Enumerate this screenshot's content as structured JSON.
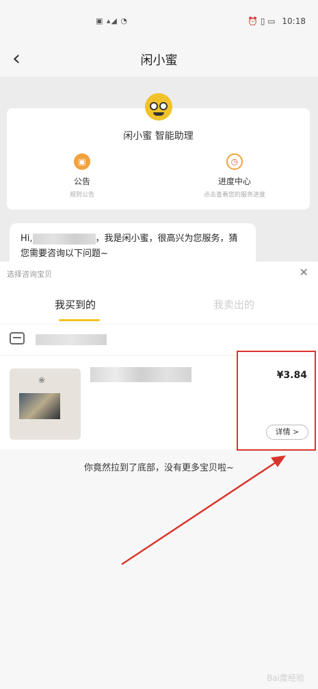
{
  "status_bar": {
    "time": "10:18"
  },
  "nav": {
    "title": "闲小蜜"
  },
  "assistant_card": {
    "title": "闲小蜜 智能助理",
    "features": [
      {
        "label": "公告",
        "sub": "规则公告",
        "icon": "notice-icon"
      },
      {
        "label": "进度中心",
        "sub": "点击查看您的服务进度",
        "icon": "clock-icon"
      }
    ]
  },
  "chat": {
    "greeting_prefix": "Hi,",
    "greeting_body": "，我是闲小蜜，很高兴为您服务，猜您需要咨询以下问题~"
  },
  "sheet": {
    "title": "选择咨询宝贝",
    "tabs": [
      {
        "label": "我买到的",
        "active": true
      },
      {
        "label": "我卖出的",
        "active": false
      }
    ],
    "item": {
      "price": "¥3.84",
      "detail_label": "详情 >"
    },
    "end_text": "你竟然拉到了底部，没有更多宝贝啦~"
  },
  "colors": {
    "accent": "#f5c31c",
    "highlight": "#d9342b",
    "background": "#ececec"
  }
}
